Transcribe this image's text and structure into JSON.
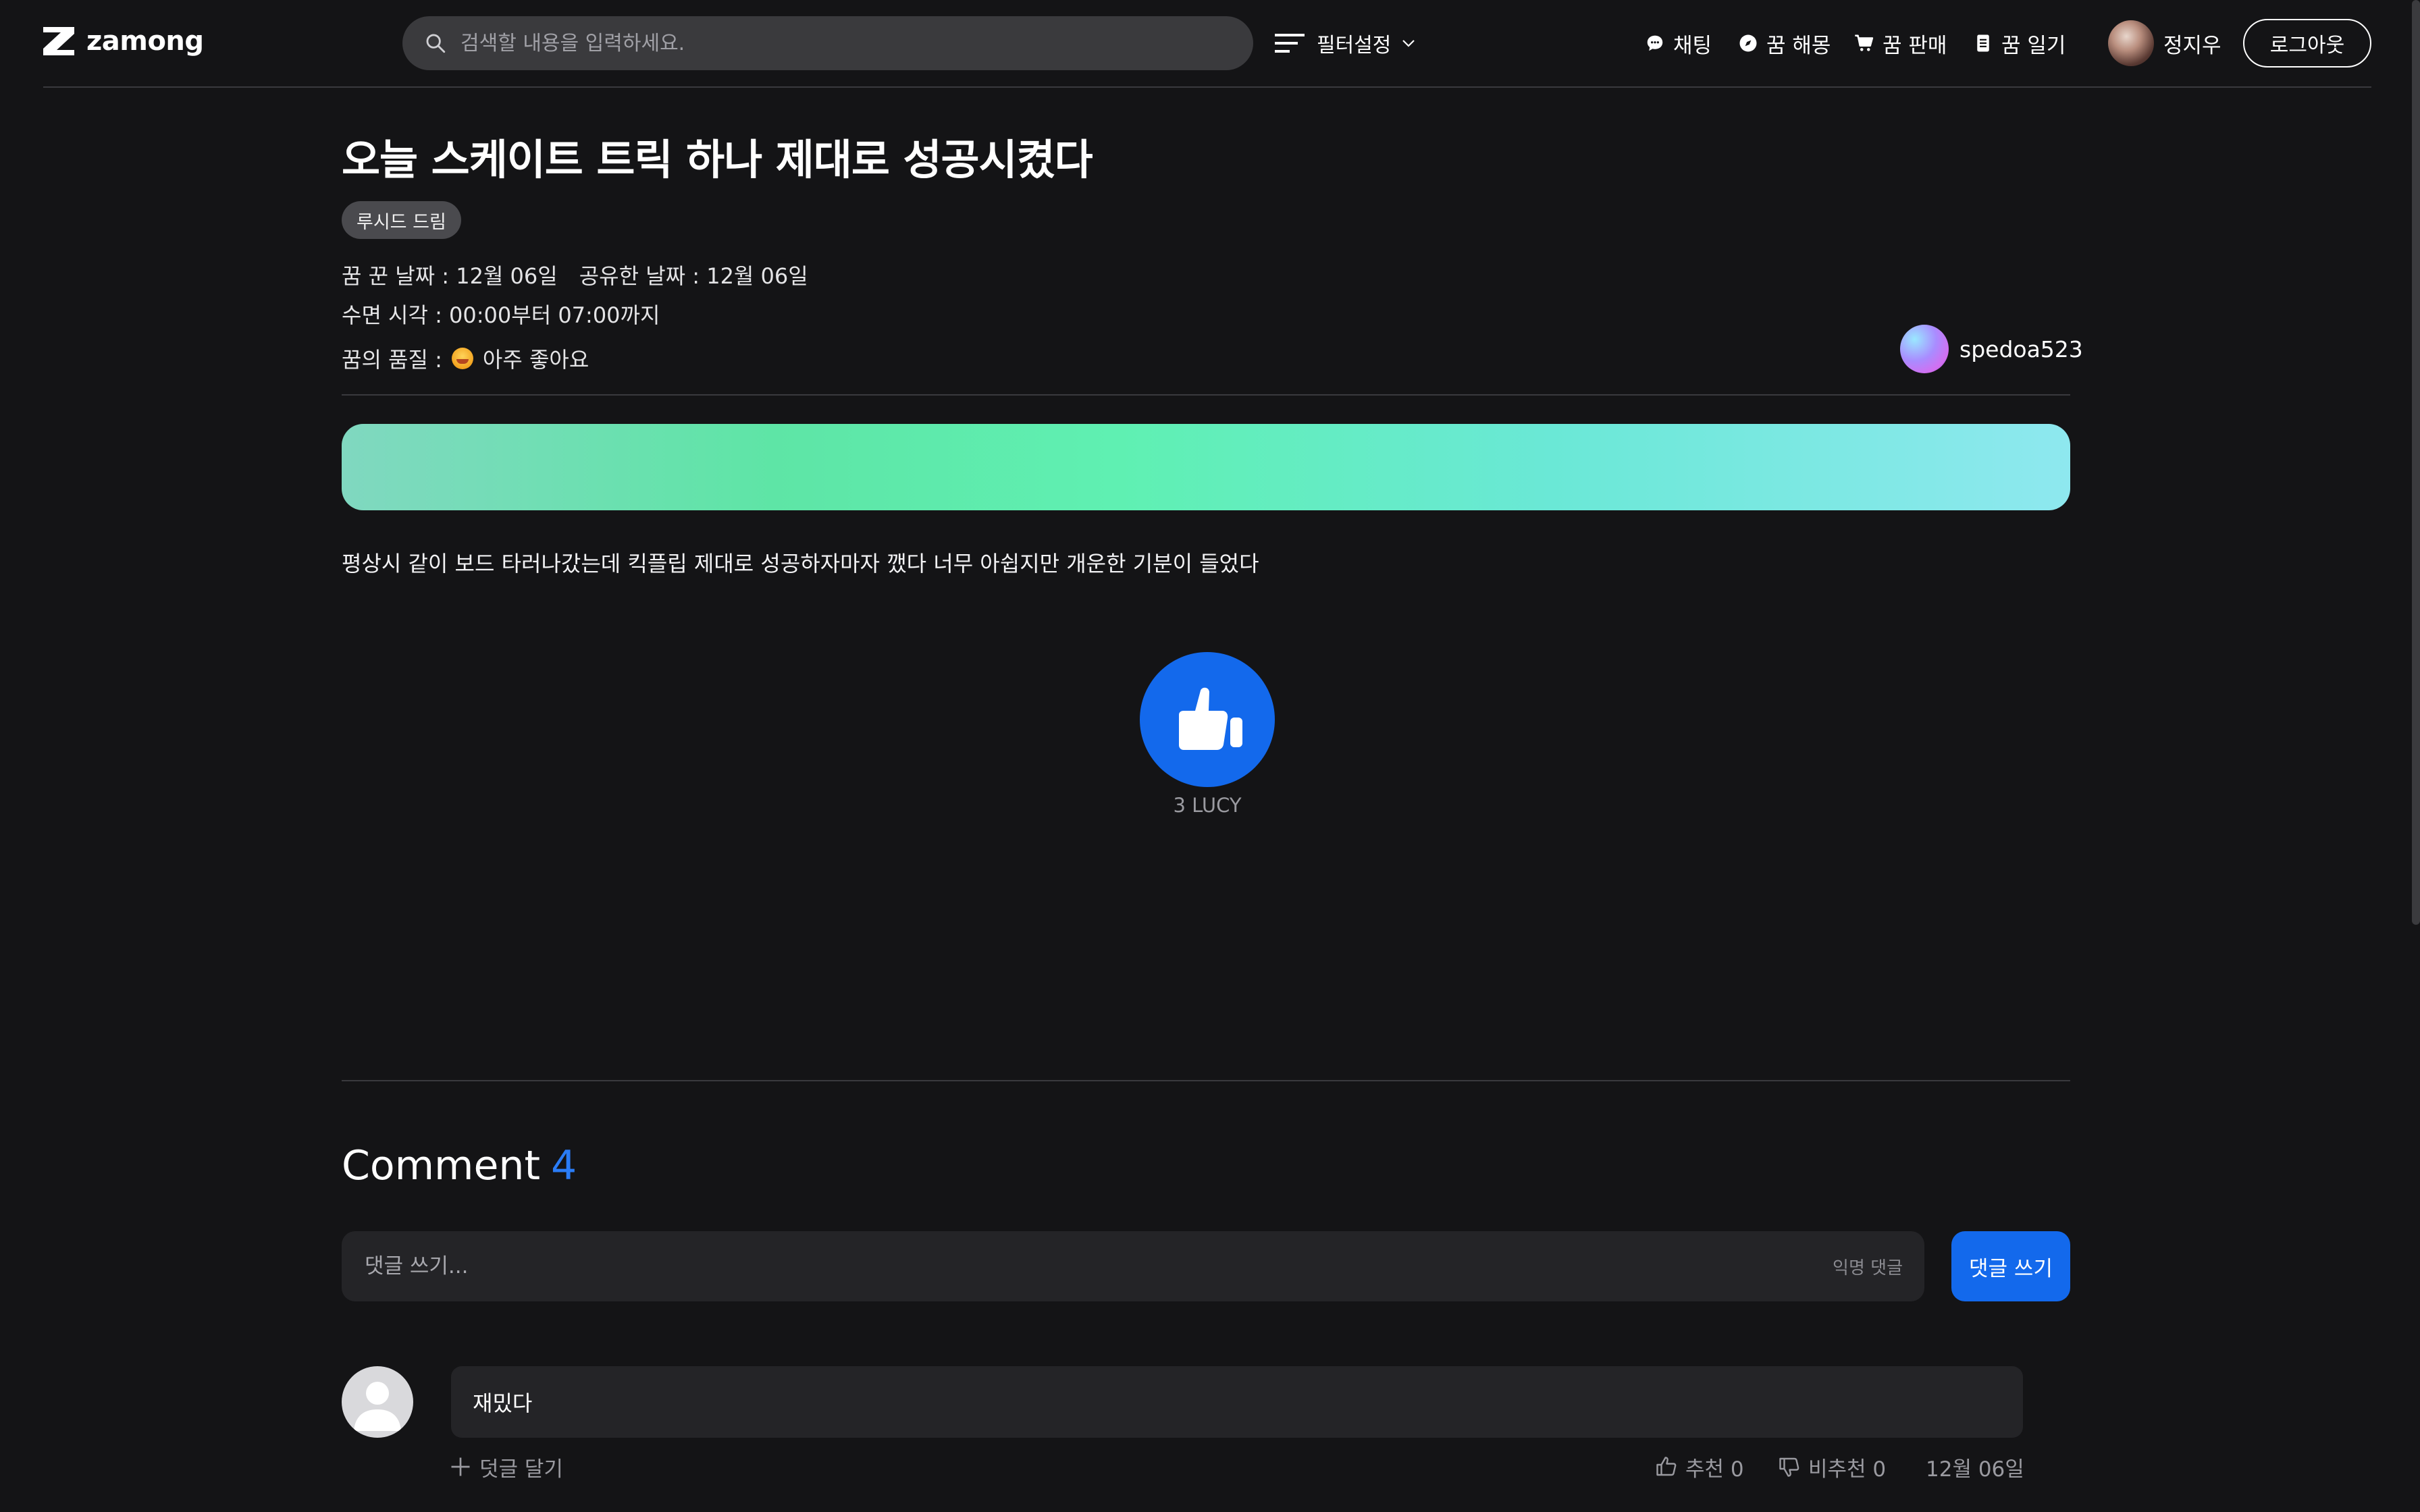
{
  "header": {
    "logo_text": "zamong",
    "search_placeholder": "검색할 내용을 입력하세요.",
    "filter_label": "필터설정",
    "nav": [
      {
        "label": "채팅",
        "icon": "chat-icon"
      },
      {
        "label": "꿈 해몽",
        "icon": "compass-icon"
      },
      {
        "label": "꿈 판매",
        "icon": "cart-icon"
      },
      {
        "label": "꿈 일기",
        "icon": "diary-icon"
      }
    ],
    "user_name": "정지우",
    "logout_label": "로그아웃"
  },
  "post": {
    "title": "오늘 스케이트 트릭 하나 제대로 성공시켰다",
    "tag": "루시드 드림",
    "dream_date": "꿈 꾼 날짜 : 12월 06일",
    "share_date": "공유한 날짜 : 12월 06일",
    "sleep_time": "수면 시각 : 00:00부터 07:00까지",
    "quality_label": "꿈의 품질 :",
    "quality_value": "아주 좋아요",
    "author": "spedoa523",
    "body": "평상시 같이 보드 타러나갔는데 킥플립 제대로 성공하자마자 깼다 너무 아쉽지만 개운한 기분이 들었다",
    "like_count": "3 LUCY"
  },
  "comments": {
    "heading": "Comment",
    "count": "4",
    "input_placeholder": "댓글 쓰기...",
    "anonymous_label": "익명 댓글",
    "submit_label": "댓글 쓰기",
    "items": [
      {
        "text": "재밌다",
        "reply_label": "덧글 달기",
        "upvote": "추천 0",
        "downvote": "비추천 0",
        "date": "12월 06일"
      }
    ]
  },
  "colors": {
    "background": "#141416",
    "accent": "#1369ec",
    "surface": "#242427"
  }
}
